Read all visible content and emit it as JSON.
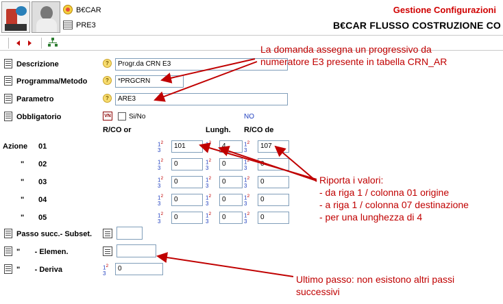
{
  "header": {
    "app_code": "B€CAR",
    "sub_code": "PRE3",
    "app_title": "Gestione Configurazioni",
    "page_title": "B€CAR FLUSSO COSTRUZIONE CO"
  },
  "form": {
    "descrizione": {
      "label": "Descrizione",
      "value": "Progr.da CRN E3"
    },
    "programma": {
      "label": "Programma/Metodo",
      "value": "*PRGCRN"
    },
    "parametro": {
      "label": "Parametro",
      "value": "ARE3"
    },
    "obbligatorio": {
      "label": "Obbligatorio",
      "checkbox_label": "Si/No",
      "value_text": "NO"
    },
    "col_headers": {
      "rco_or": "R/CO or",
      "lungh": "Lungh.",
      "rco_de": "R/CO de"
    },
    "azioni": [
      {
        "label": "Azione",
        "num": "01",
        "or": "101",
        "len": "4",
        "de": "107"
      },
      {
        "label": "\"",
        "num": "02",
        "or": "0",
        "len": "0",
        "de": "0"
      },
      {
        "label": "\"",
        "num": "03",
        "or": "0",
        "len": "0",
        "de": "0"
      },
      {
        "label": "\"",
        "num": "04",
        "or": "0",
        "len": "0",
        "de": "0"
      },
      {
        "label": "\"",
        "num": "05",
        "or": "0",
        "len": "0",
        "de": "0"
      }
    ],
    "passo": {
      "label": "Passo succ.- Subset.",
      "value": ""
    },
    "elemen": {
      "label": "\"       - Elemen.",
      "value": ""
    },
    "deriva": {
      "label": "\"       - Deriva",
      "value": "0"
    },
    "num_icon": {
      "a": "1",
      "b": "2",
      "c": "3"
    }
  },
  "annotations": {
    "top": [
      "La domanda assegna un progressivo da",
      "numeratore E3 presente in tabella CRN_AR"
    ],
    "middle": [
      "Riporta i valori:",
      "- da riga 1 / colonna 01 origine",
      "- a riga 1 / colonna 07 destinazione",
      "- per una lunghezza di 4"
    ],
    "bottom": [
      "Ultimo passo: non esistono altri passi",
      "successivi"
    ]
  },
  "colors": {
    "annotation": "#c00000",
    "title_red": "#d00000",
    "nav_red": "#c00000"
  }
}
